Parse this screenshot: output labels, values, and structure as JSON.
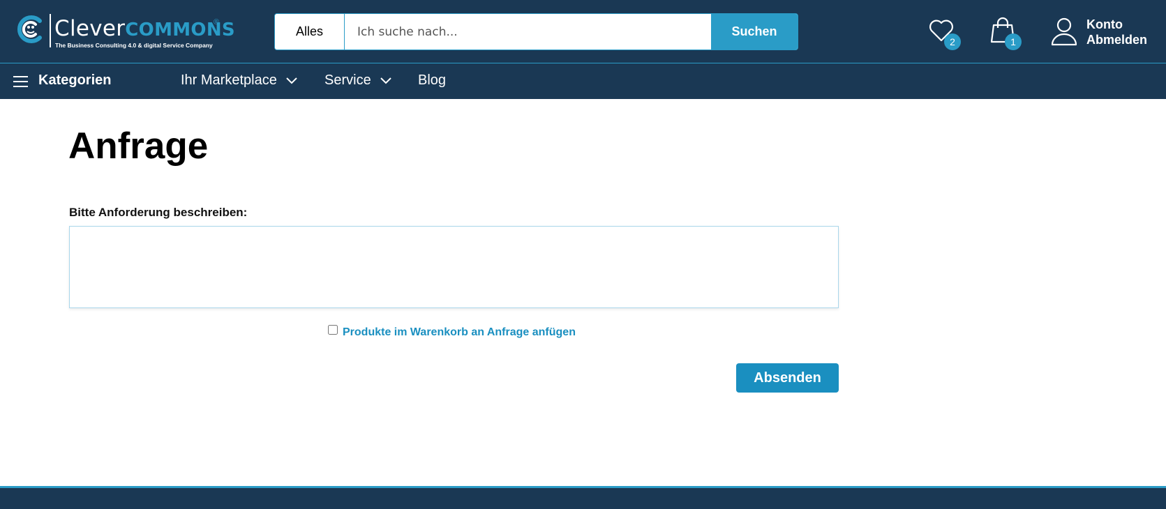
{
  "header": {
    "logo": {
      "word_clever": "Clever",
      "word_commons": "COMMONS",
      "registered": "®",
      "tagline": "The Business Consulting 4.0 & digital Service Company"
    },
    "search": {
      "scope": "Alles",
      "placeholder": "Ich suche nach...",
      "button_label": "Suchen"
    },
    "wishlist": {
      "count": "2",
      "icon": "heart-icon"
    },
    "cart": {
      "count": "1",
      "icon": "shopping-bag-icon"
    },
    "account": {
      "icon": "user-icon",
      "konto_label": "Konto",
      "logout_label": "Abmelden"
    }
  },
  "nav": {
    "categories_label": "Kategorien",
    "items": [
      {
        "label": "Ihr Marketplace",
        "has_dropdown": true
      },
      {
        "label": "Service",
        "has_dropdown": true
      },
      {
        "label": "Blog",
        "has_dropdown": false
      }
    ]
  },
  "main": {
    "title": "Anfrage",
    "description_label": "Bitte Anforderung beschreiben:",
    "description_value": "",
    "attach_cart_label": "Produkte im Warenkorb an Anfrage anfügen",
    "attach_cart_checked": false,
    "submit_label": "Absenden"
  },
  "colors": {
    "header_bg": "#1a3854",
    "accent": "#2a9cc7",
    "link": "#1a8fc0"
  }
}
